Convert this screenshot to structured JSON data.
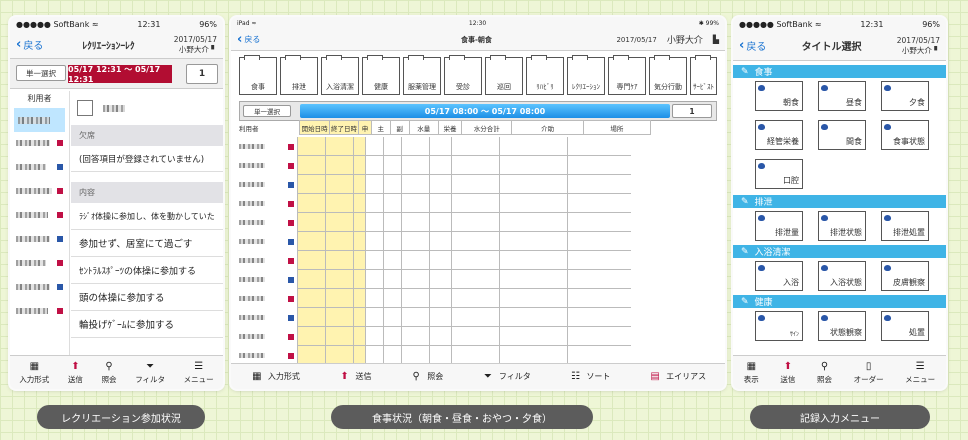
{
  "device1": {
    "status": {
      "carrier": "●●●●● SoftBank ≈",
      "time": "12:31",
      "battery": "96%"
    },
    "back_label": "戻る",
    "title": "ﾚｸﾘｴｰｼｮﾝｰﾚｸ",
    "date": "2017/05/17",
    "user": "小野大介",
    "select_label": "単一選択",
    "range": "05/17 12:31 ～ 05/17 12:31",
    "page": "1",
    "user_col": "利用者",
    "sections": [
      {
        "label": "欠席",
        "options": [
          "(回答項目が登録されていません)"
        ]
      },
      {
        "label": "内容",
        "options": [
          "ﾗｼﾞｵ体操に参加し、体を動かしていた",
          "参加せず、居室にて過ごす",
          "ｾﾝﾄﾗﾙｽﾎﾟｰﾂの体操に参加する",
          "頭の体操に参加する",
          "輪投げｹﾞｰﾑに参加する"
        ]
      }
    ],
    "toolbar": [
      {
        "label": "入力形式",
        "icon": "input-format-icon"
      },
      {
        "label": "送信",
        "icon": "send-icon"
      },
      {
        "label": "照会",
        "icon": "search-icon"
      },
      {
        "label": "フィルタ",
        "icon": "filter-icon"
      },
      {
        "label": "メニュー",
        "icon": "menu-icon"
      }
    ]
  },
  "device2": {
    "status": {
      "carrier": "iPad ≈",
      "time": "12:30",
      "battery": "✱ 99%"
    },
    "back_label": "戻る",
    "title": "食事-朝食",
    "date": "2017/05/17",
    "user": "小野大介",
    "folders": [
      "食事",
      "排泄",
      "入浴清潔",
      "健康",
      "服薬管理",
      "受診",
      "巡回",
      "ﾘﾊﾋﾞﾘ",
      "ﾚｸﾘｴｰｼｮﾝ",
      "専門ｹｱ",
      "気分行動",
      "ｻｰﾋﾞｽﾄ"
    ],
    "select_label": "単一選択",
    "range": "05/17 08:00 ～ 05/17 08:00",
    "page": "1",
    "columns": [
      "利用者",
      "開始日時",
      "終了日時",
      "申",
      "主",
      "副",
      "水量",
      "栄養",
      "水分合計",
      "介助",
      "場所"
    ],
    "toolbar": [
      {
        "label": "入力形式",
        "icon": "input-format-icon"
      },
      {
        "label": "送信",
        "icon": "send-icon"
      },
      {
        "label": "照会",
        "icon": "search-icon"
      },
      {
        "label": "フィルタ",
        "icon": "filter-icon"
      },
      {
        "label": "ソート",
        "icon": "sort-icon"
      },
      {
        "label": "エイリアス",
        "icon": "alias-icon"
      }
    ]
  },
  "device3": {
    "status": {
      "carrier": "●●●●● SoftBank ≈",
      "time": "12:31",
      "battery": "96%"
    },
    "back_label": "戻る",
    "title": "タイトル選択",
    "date": "2017/05/17",
    "user": "小野大介",
    "categories": [
      {
        "label": "食事",
        "items": [
          "朝食",
          "昼食",
          "夕食",
          "経管栄養",
          "間食",
          "食事状態",
          "口腔"
        ]
      },
      {
        "label": "排泄",
        "items": [
          "排泄量",
          "排泄状態",
          "排泄処置"
        ]
      },
      {
        "label": "入浴清潔",
        "items": [
          "入浴",
          "入浴状態",
          "皮膚観察"
        ]
      },
      {
        "label": "健康",
        "items": [
          "ｻｲﾝ",
          "状態観察",
          "処置"
        ]
      }
    ],
    "toolbar": [
      {
        "label": "表示",
        "icon": "display-icon"
      },
      {
        "label": "送信",
        "icon": "send-icon"
      },
      {
        "label": "照会",
        "icon": "search-icon"
      },
      {
        "label": "オーダー",
        "icon": "order-icon"
      },
      {
        "label": "メニュー",
        "icon": "menu-icon"
      }
    ]
  },
  "captions": [
    "レクリエーション参加状況",
    "食事状況（朝食・昼食・おやつ・夕食）",
    "記録入力メニュー"
  ],
  "colors": {
    "accent": "#1a73d1",
    "badge": "#b20d32",
    "category": "#3fb4e6",
    "highlight": "#fff3b0",
    "background": "#eef6d6"
  }
}
